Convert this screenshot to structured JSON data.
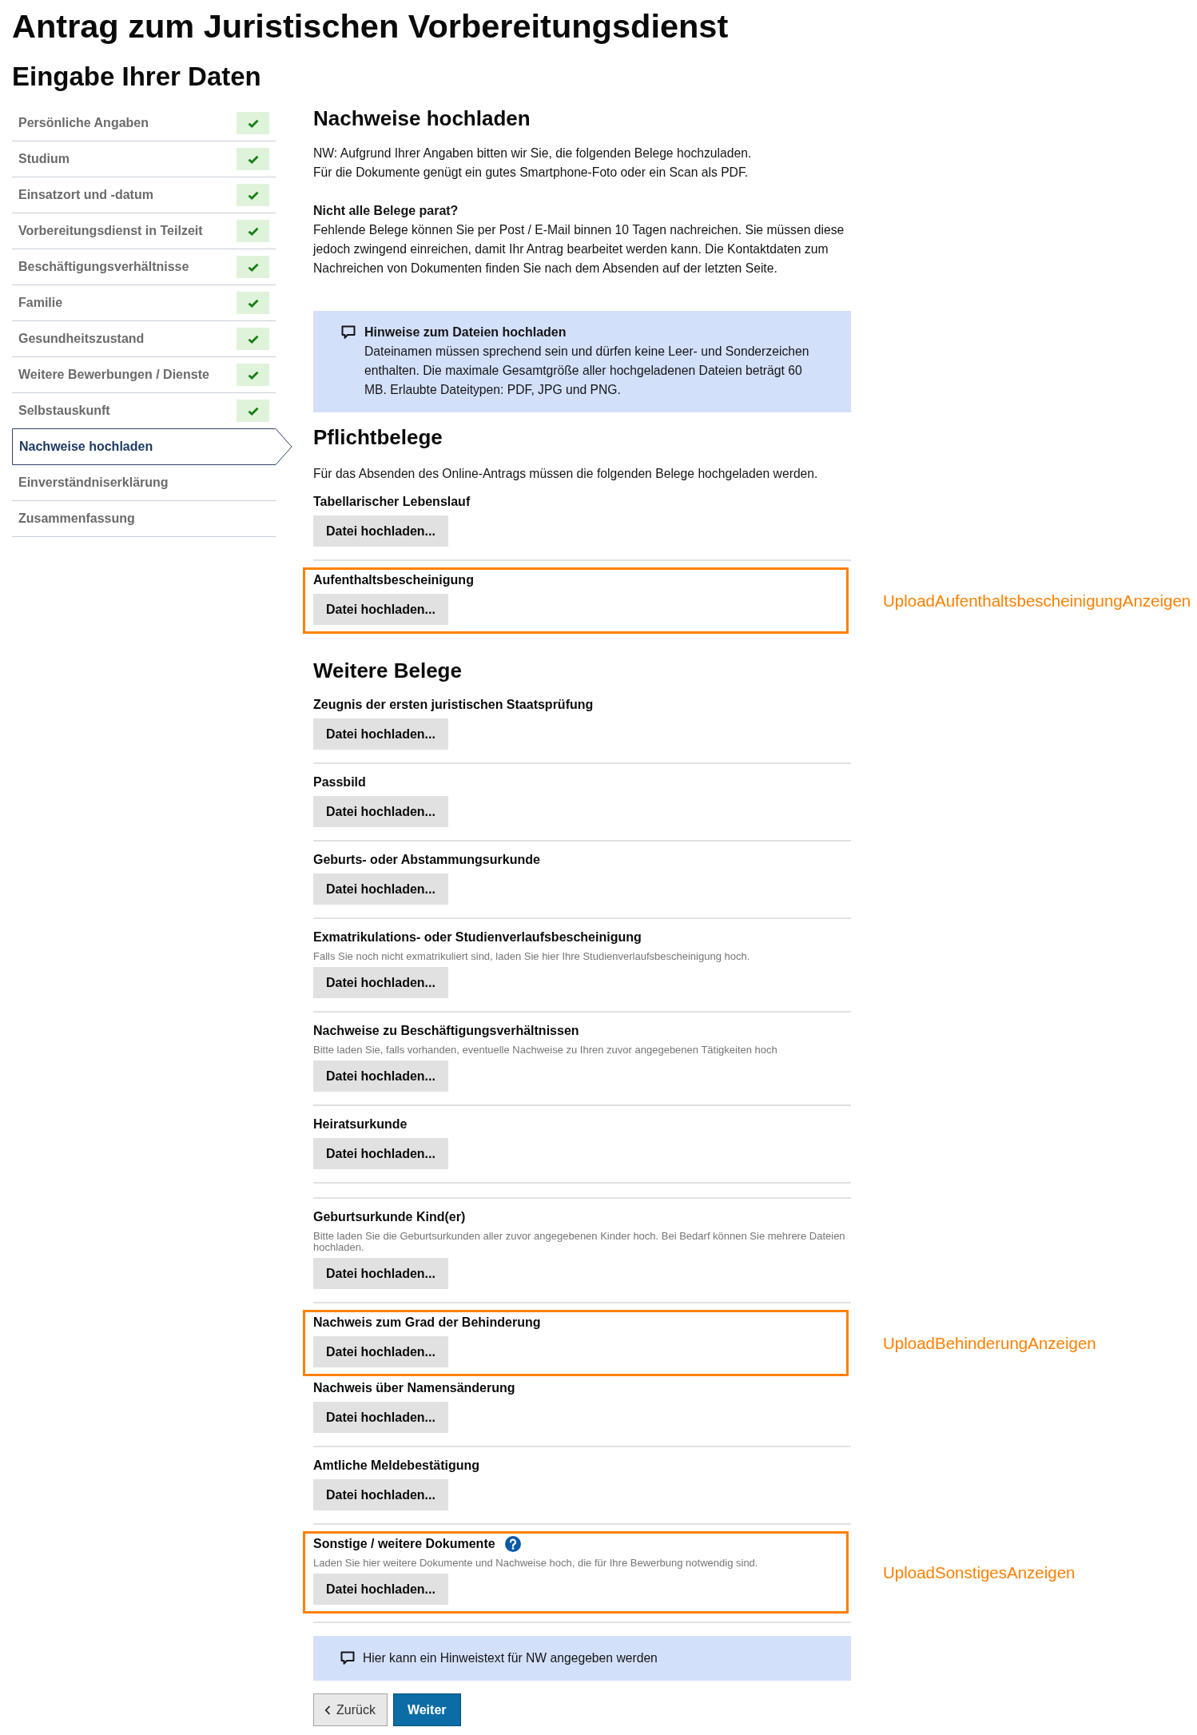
{
  "header": {
    "title": "Antrag zum Juristischen Vorbereitungsdienst",
    "subtitle": "Eingabe Ihrer Daten"
  },
  "sidebar": {
    "items": [
      {
        "label": "Persönliche Angaben",
        "completed": true,
        "selected": false
      },
      {
        "label": "Studium",
        "completed": true,
        "selected": false
      },
      {
        "label": "Einsatzort und -datum",
        "completed": true,
        "selected": false
      },
      {
        "label": "Vorbereitungsdienst in Teilzeit",
        "completed": true,
        "selected": false
      },
      {
        "label": "Beschäftigungsverhältnisse",
        "completed": true,
        "selected": false
      },
      {
        "label": "Familie",
        "completed": true,
        "selected": false
      },
      {
        "label": "Gesundheitszustand",
        "completed": true,
        "selected": false
      },
      {
        "label": "Weitere Bewerbungen / Dienste",
        "completed": true,
        "selected": false
      },
      {
        "label": "Selbstauskunft",
        "completed": true,
        "selected": false
      },
      {
        "label": "Nachweise hochladen",
        "completed": false,
        "selected": true
      },
      {
        "label": "Einverständniserklärung",
        "completed": false,
        "selected": false
      },
      {
        "label": "Zusammenfassung",
        "completed": false,
        "selected": false
      }
    ]
  },
  "content": {
    "heading": "Nachweise hochladen",
    "intro": [
      "NW: Aufgrund Ihrer Angaben bitten wir Sie, die folgenden Belege hochzuladen.",
      "Für die Dokumente genügt ein gutes Smartphone-Foto oder ein Scan als PDF."
    ],
    "missing": {
      "title": "Nicht alle Belege parat?",
      "text": "Fehlende Belege können Sie per Post / E-Mail binnen 10 Tagen nachreichen. Sie müssen diese jedoch zwingend einreichen, damit Ihr Antrag bearbeitet werden kann. Die Kontaktdaten zum Nachreichen von Dokumenten finden Sie nach dem Absenden auf der letzten Seite."
    },
    "notice": {
      "title": "Hinweise zum Dateien hochladen",
      "text": "Dateinamen müssen sprechend sein und dürfen keine Leer- und Sonderzeichen enthalten. Die maximale Gesamtgröße aller hochgeladenen Dateien beträgt 60 MB. Erlaubte Dateitypen: PDF, JPG und PNG."
    },
    "sections": [
      {
        "heading": "Pflichtbelege",
        "text": "Für das Absenden des Online-Antrags müssen die folgenden Belege hochgeladen werden.",
        "items": [
          {
            "kind": "upload",
            "title": "Tabellarischer Lebenslauf",
            "button": "Datei hochladen...",
            "help": false
          },
          {
            "kind": "divider"
          },
          {
            "kind": "upload",
            "title": "Aufenthaltsbescheinigung",
            "button": "Datei hochladen...",
            "help": false,
            "annotation": "UploadAufenthaltsbescheinigungAnzeigen"
          }
        ]
      },
      {
        "heading": "Weitere Belege",
        "items": [
          {
            "kind": "upload",
            "title": "Zeugnis der ersten juristischen Staatsprüfung",
            "button": "Datei hochladen...",
            "help": false
          },
          {
            "kind": "divider"
          },
          {
            "kind": "upload",
            "title": "Passbild",
            "button": "Datei hochladen...",
            "help": false
          },
          {
            "kind": "divider"
          },
          {
            "kind": "upload",
            "title": "Geburts- oder Abstammungsurkunde",
            "button": "Datei hochladen...",
            "help": false
          },
          {
            "kind": "divider"
          },
          {
            "kind": "upload",
            "title": "Exmatrikulations- oder Studienverlaufsbescheinigung",
            "description": "Falls Sie noch nicht exmatrikuliert sind, laden Sie hier Ihre Studienverlaufsbescheinigung hoch.",
            "button": "Datei hochladen...",
            "help": false
          },
          {
            "kind": "divider"
          },
          {
            "kind": "upload",
            "title": "Nachweise zu Beschäftigungsverhältnissen",
            "description": "Bitte laden Sie, falls vorhanden, eventuelle Nachweise zu Ihren zuvor angegebenen Tätigkeiten hoch",
            "button": "Datei hochladen...",
            "help": false
          },
          {
            "kind": "divider"
          },
          {
            "kind": "upload",
            "title": "Heiratsurkunde",
            "button": "Datei hochladen...",
            "help": false
          },
          {
            "kind": "divider"
          },
          {
            "kind": "divider"
          },
          {
            "kind": "upload",
            "title": "Geburtsurkunde Kind(er)",
            "description": "Bitte laden Sie die Geburtsurkunden aller zuvor angegebenen Kinder hoch. Bei Bedarf können Sie mehrere Dateien hochladen.",
            "button": "Datei hochladen...",
            "help": false
          },
          {
            "kind": "divider"
          },
          {
            "kind": "upload",
            "title": "Nachweis zum Grad der Behinderung",
            "button": "Datei hochladen...",
            "help": false,
            "annotation": "UploadBehinderungAnzeigen"
          },
          {
            "kind": "upload",
            "title": "Nachweis über Namensänderung",
            "button": "Datei hochladen...",
            "help": false
          },
          {
            "kind": "divider"
          },
          {
            "kind": "upload",
            "title": "Amtliche Meldebestätigung",
            "button": "Datei hochladen...",
            "help": false
          },
          {
            "kind": "divider"
          },
          {
            "kind": "upload",
            "title": "Sonstige / weitere Dokumente",
            "description": "Laden Sie hier weitere Dokumente und Nachweise hoch, die für Ihre Bewerbung notwendig sind.",
            "button": "Datei hochladen...",
            "help": true,
            "annotation": "UploadSonstigesAnzeigen"
          },
          {
            "kind": "divider"
          }
        ]
      }
    ],
    "footer_notice": {
      "text": "Hier kann ein Hinweistext für NW angegeben werden"
    },
    "buttons": [
      {
        "kind": "back",
        "label": "Zurück"
      },
      {
        "kind": "primary",
        "label": "Weiter"
      }
    ]
  }
}
